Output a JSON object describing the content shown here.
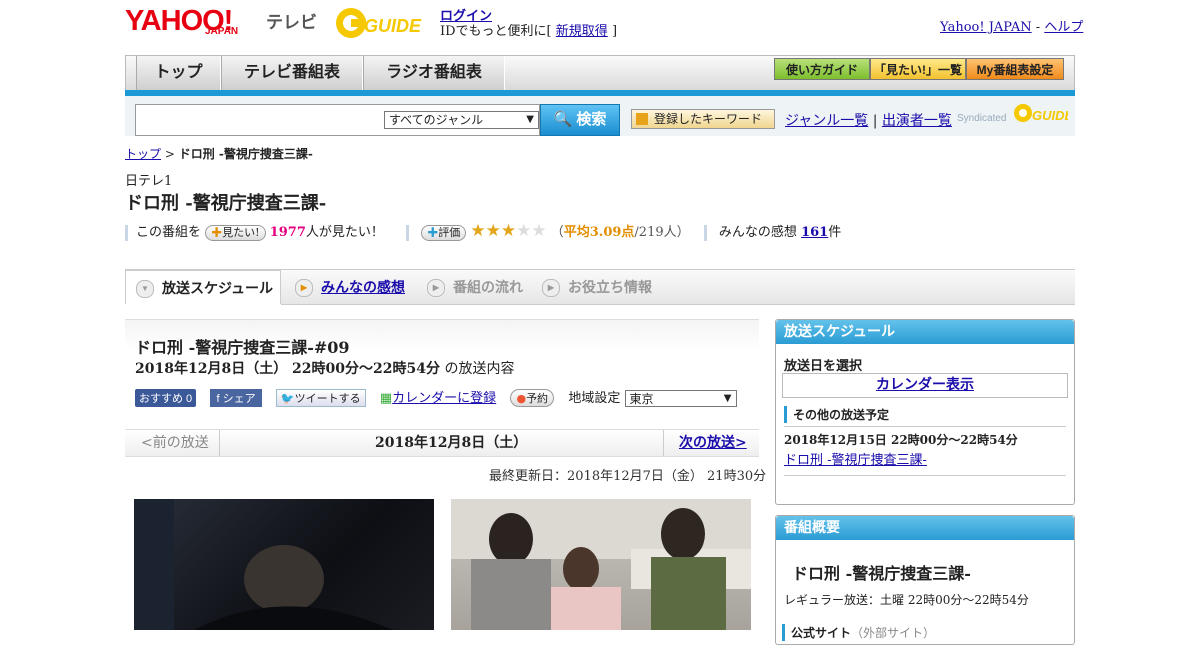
{
  "header": {
    "brand": "YAHOO!",
    "brand_sub": "JAPAN",
    "section": "テレビ",
    "gguide": "GUIDE",
    "login": "ログイン",
    "id_text_prefix": "IDでもっと便利に[",
    "new_account": "新規取得",
    "id_text_suffix": "]",
    "yahoo_japan": "Yahoo! JAPAN",
    "sep": "-",
    "help": "ヘルプ"
  },
  "nav": {
    "tabs": [
      "トップ",
      "テレビ番組表",
      "ラジオ番組表"
    ],
    "right_buttons": [
      "使い方ガイド",
      "「見たい!」一覧",
      "My番組表設定"
    ]
  },
  "search": {
    "genre": "すべてのジャンル",
    "button": "検索",
    "keyword_button": "登録したキーワード",
    "genre_list": "ジャンル一覧",
    "divider": "|",
    "performers": "出演者一覧",
    "syndicated": "Syndicated"
  },
  "breadcrumb": {
    "top": "トップ",
    "sep": ">",
    "current": "ドロ刑 -警視庁捜査三課-"
  },
  "program": {
    "channel": "日テレ1",
    "title": "ドロ刑 -警視庁捜査三課-",
    "mitai_prefix": "この番組を",
    "mitai_btn": "見たい!",
    "mitai_count": "1977",
    "mitai_suffix": "人が見たい！",
    "rate_btn": "評価",
    "stars": 3,
    "stars_total": 5,
    "avg_open": "（",
    "avg_label": "平均3.09点",
    "avg_count": "/219人）",
    "reviews_prefix": "みんなの感想",
    "reviews_count": "161",
    "reviews_suffix": "件"
  },
  "tabs": [
    "放送スケジュール",
    "みんなの感想",
    "番組の流れ",
    "お役立ち情報"
  ],
  "episode": {
    "title": "ドロ刑 -警視庁捜査三課-#09",
    "date": "2018年12月8日（土） 22時00分～22時54分",
    "date_suffix": "の放送内容",
    "fb_like": "おすすめ 0",
    "fb_share": "シェア",
    "tweet": "ツイートする",
    "calendar": "カレンダーに登録",
    "reserve": "予約",
    "region_label": "地域設定",
    "region": "東京",
    "prev": "<前の放送",
    "current": "2018年12月8日（土）",
    "next": "次の放送>",
    "updated": "最終更新日：2018年12月7日（金） 21時30分"
  },
  "sidebar": {
    "schedule_title": "放送スケジュール",
    "select_date": "放送日を選択",
    "calendar": "カレンダー表示",
    "other_title": "その他の放送予定",
    "other_date": "2018年12月15日 22時00分～22時54分",
    "other_link": "ドロ刑 -警視庁捜査三課-",
    "summary_title": "番組概要",
    "summary_name": "ドロ刑 -警視庁捜査三課-",
    "regular": "レギュラー放送：土曜 22時00分～22時54分",
    "official_site": "公式サイト",
    "external": "（外部サイト）"
  }
}
